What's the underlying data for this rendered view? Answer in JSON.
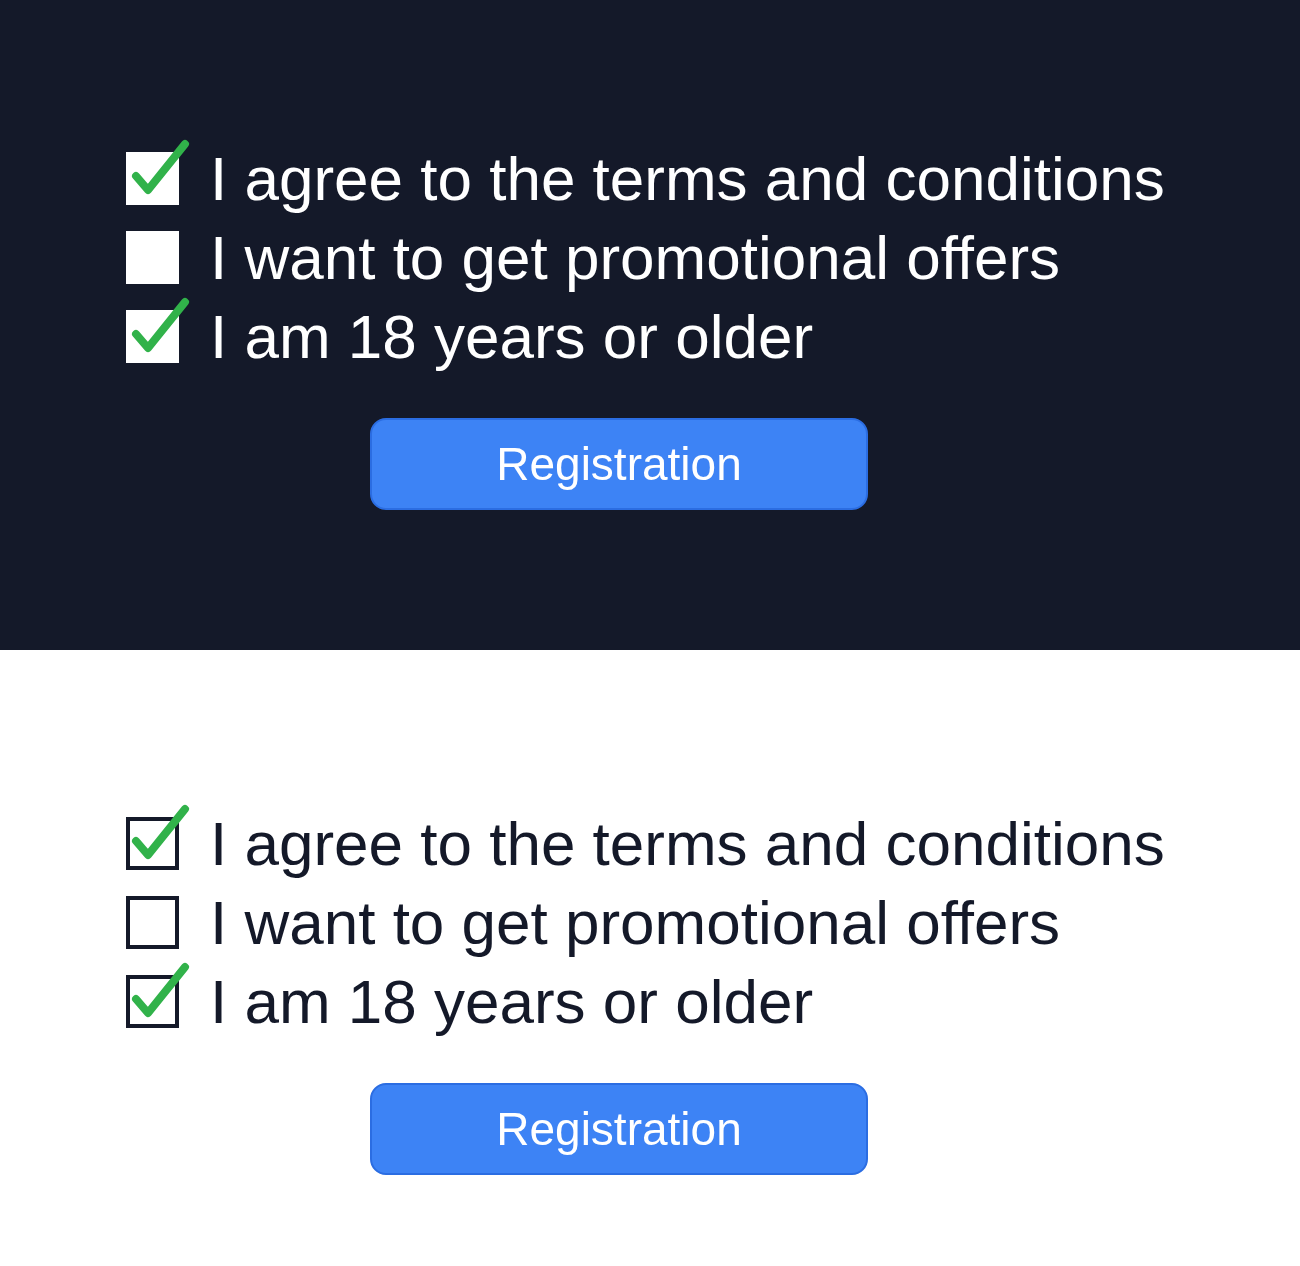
{
  "panels": [
    {
      "kind": "dark",
      "options": [
        {
          "label": "I agree to the terms and conditions",
          "checked": true
        },
        {
          "label": "I want to get promotional offers",
          "checked": false
        },
        {
          "label": "I am 18 years or older",
          "checked": true
        }
      ],
      "button": "Registration"
    },
    {
      "kind": "light",
      "options": [
        {
          "label": "I agree to the terms and conditions",
          "checked": true
        },
        {
          "label": "I want to get promotional offers",
          "checked": false
        },
        {
          "label": "I am 18 years or older",
          "checked": true
        }
      ],
      "button": "Registration"
    }
  ]
}
